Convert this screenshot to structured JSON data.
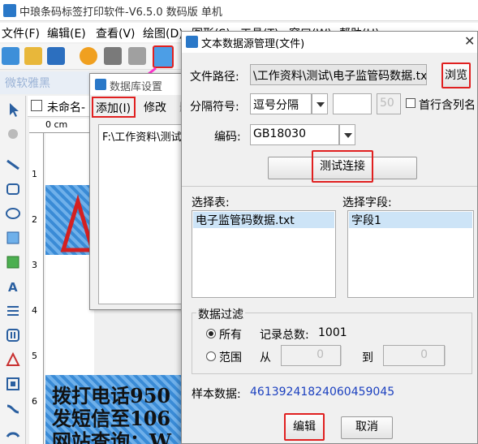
{
  "app": {
    "title": "中琅条码标签打印软件-V6.5.0 数码版 单机",
    "menu": [
      "文件(F)",
      "编辑(E)",
      "查看(V)",
      "绘图(D)",
      "图形(S)",
      "工具(T)",
      "窗口(W)",
      "帮助(H)"
    ],
    "sub_toolbar_text": "微软雅黑",
    "doc_tab": "未命名-",
    "ruler_label": "0 cm",
    "ruler_v_marks": [
      "1",
      "2",
      "3",
      "4",
      "5",
      "6"
    ],
    "label_lines": [
      "拨打电话950",
      "发短信至106",
      "网站查询：W"
    ]
  },
  "db_dialog": {
    "title": "数据库设置",
    "buttons": [
      "添加(I)",
      "修改",
      "删"
    ],
    "list_items": [
      "F:\\工作资料\\测试"
    ]
  },
  "ds_dialog": {
    "title": "文本数据源管理(文件)",
    "close": "✕",
    "file_path_label": "文件路径:",
    "file_path_value": "\\工作资料\\测试\\电子监管码数据.txt",
    "browse_button": "浏览",
    "separator_label": "分隔符号:",
    "separator_value": "逗号分隔",
    "separator_custom": "",
    "separator_count": "50",
    "first_row_label": "首行含列名",
    "encoding_label": "编码:",
    "encoding_value": "GB18030",
    "test_button": "测试连接",
    "tables_label": "选择表:",
    "tables": [
      "电子监管码数据.txt"
    ],
    "fields_label": "选择字段:",
    "fields": [
      "字段1"
    ],
    "filter_group": "数据过滤",
    "all_label": "所有",
    "total_label": "记录总数:",
    "total_value": "1001",
    "range_label": "范围",
    "from_label": "从",
    "from_value": "0",
    "to_label": "到",
    "to_value": "0",
    "sample_label": "样本数据:",
    "sample_value": "46139241824060459045",
    "edit_button": "编辑",
    "cancel_button": "取消",
    "sample_color": "#1a3fbf"
  }
}
